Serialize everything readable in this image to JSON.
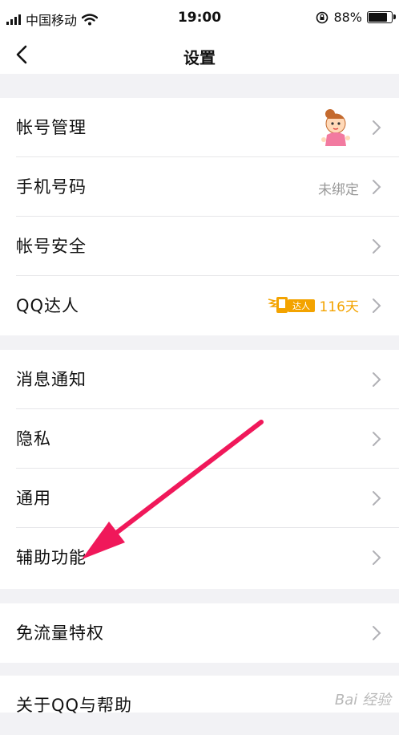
{
  "status_bar": {
    "carrier": "中国移动",
    "time": "19:00",
    "battery_percent": "88%",
    "battery_level": 0.88
  },
  "nav": {
    "title": "设置"
  },
  "groups": [
    {
      "items": [
        {
          "label": "帐号管理"
        },
        {
          "label": "手机号码",
          "value": "未绑定"
        },
        {
          "label": "帐号安全"
        },
        {
          "label": "QQ达人",
          "badge_text": "达人",
          "days": "116天"
        }
      ]
    },
    {
      "items": [
        {
          "label": "消息通知"
        },
        {
          "label": "隐私"
        },
        {
          "label": "通用"
        },
        {
          "label": "辅助功能"
        }
      ]
    },
    {
      "items": [
        {
          "label": "免流量特权"
        }
      ]
    },
    {
      "items": [
        {
          "label": "关于QQ与帮助"
        }
      ]
    }
  ],
  "colors": {
    "annotation_arrow": "#f0185a",
    "badge": "#f3a300"
  },
  "watermark": "Bai 经验"
}
